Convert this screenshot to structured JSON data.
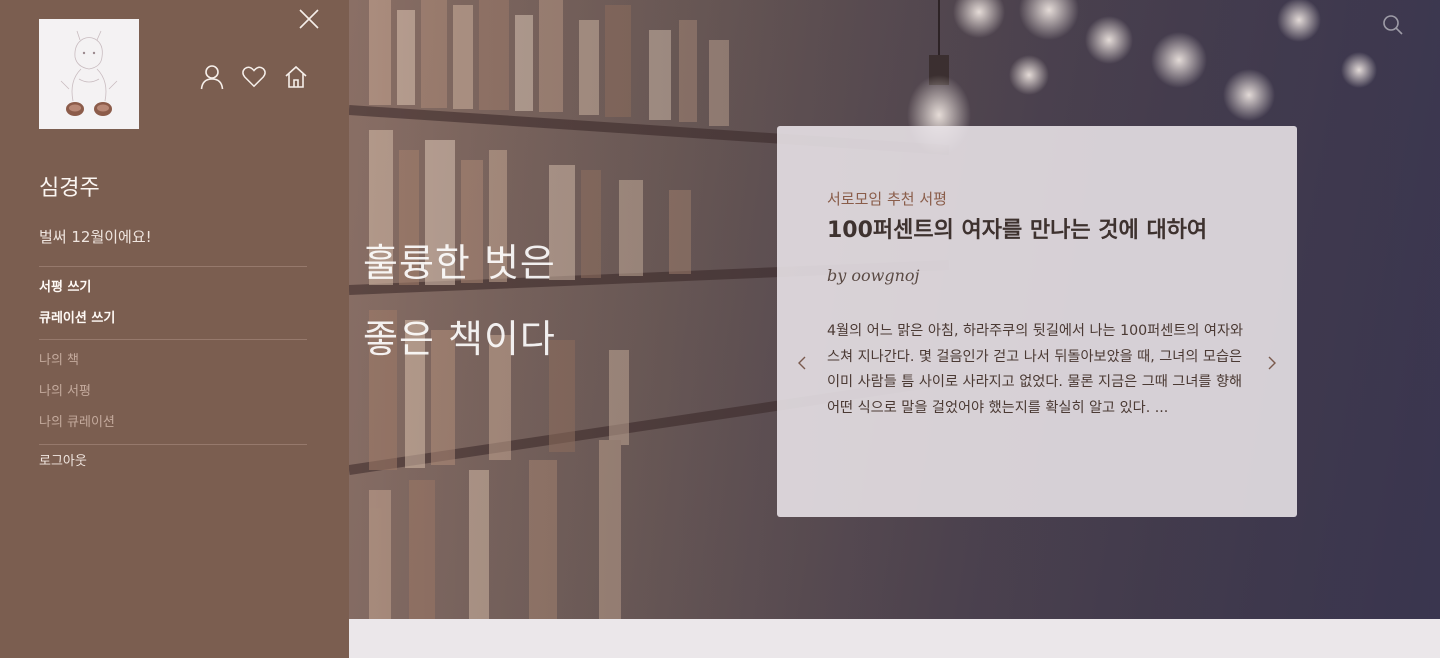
{
  "sidebar": {
    "user_name": "심경주",
    "greeting": "벌써 12월이에요!",
    "icons": {
      "close": "close-icon",
      "user": "user-icon",
      "heart": "heart-icon",
      "home": "home-icon"
    },
    "primary_menu": [
      "서평 쓰기",
      "큐레이션 쓰기"
    ],
    "secondary_menu": [
      "나의 책",
      "나의 서평",
      "나의 큐레이션"
    ],
    "logout": "로그아웃",
    "colors": {
      "background": "#7b5e50",
      "muted_text": "#c4aa9d"
    }
  },
  "hero": {
    "quote_line1": "훌륭한 벗은",
    "quote_line2": "좋은 책이다",
    "search_icon": "search-icon"
  },
  "review_card": {
    "category": "서로모임 추천 서평",
    "title": "100퍼센트의 여자를 만나는 것에 대하여",
    "author": "by oowgnoj",
    "excerpt": "4월의 어느 맑은 아침, 하라주쿠의 뒷길에서 나는 100퍼센트의 여자와 스쳐 지나간다. 몇 걸음인가 걷고 나서 뒤돌아보았을 때, 그녀의 모습은 이미 사람들 틈 사이로 사라지고 없었다. 물론 지금은 그때 그녀를 향해 어떤 식으로 말을 걸었어야 했는지를 확실히 알고 있다. ...",
    "prev_icon": "chevron-left-icon",
    "next_icon": "chevron-right-icon"
  }
}
